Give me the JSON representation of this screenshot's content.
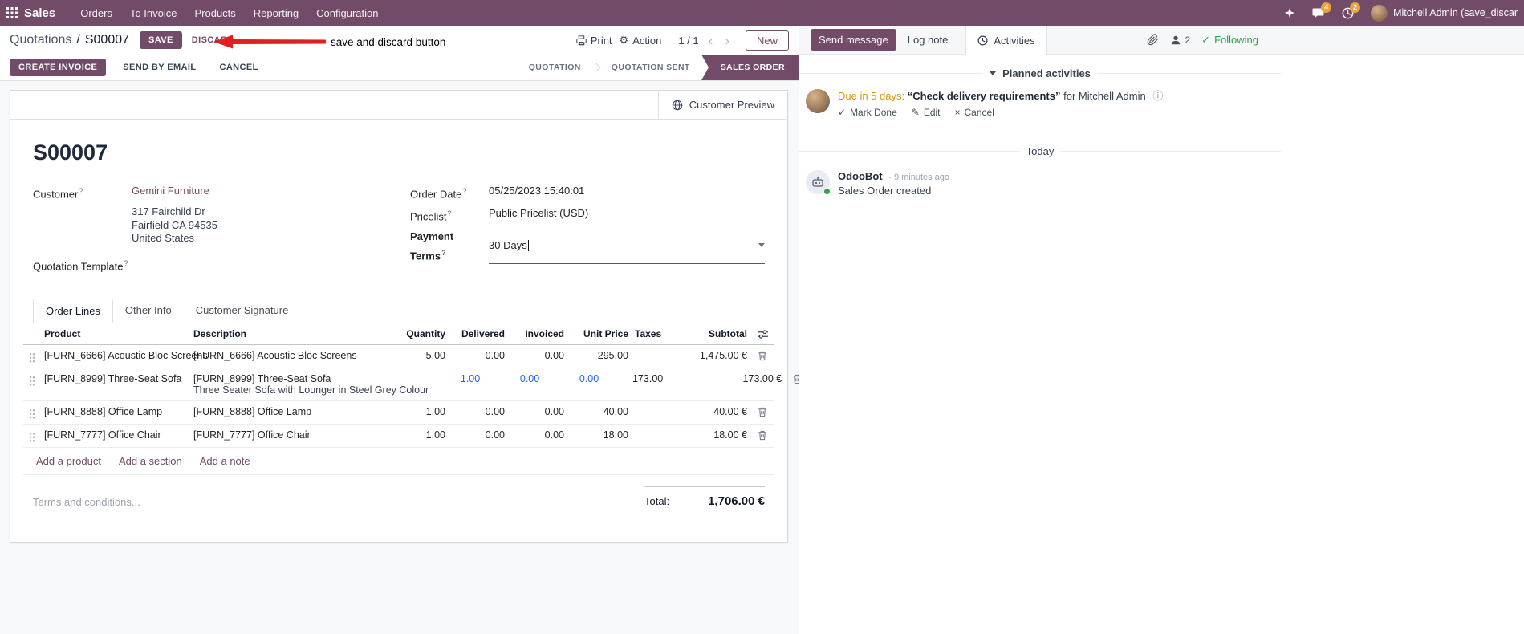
{
  "colors": {
    "brand_purple": "#714B67",
    "link_purple": "#714B67",
    "edited_value_blue": "#2563eb",
    "activity_due_orange": "#d9930d",
    "following_green": "#28a745",
    "badge_amber": "#EAA335",
    "annotation_red": "#e02020"
  },
  "icons": {
    "help": "?",
    "gear": "⚙",
    "chevron_left": "‹",
    "chevron_right": "›",
    "info": "ⓘ",
    "check": "✓",
    "pencil": "✎",
    "cross": "×"
  },
  "navbar": {
    "brand": "Sales",
    "menus": [
      "Orders",
      "To Invoice",
      "Products",
      "Reporting",
      "Configuration"
    ],
    "message_badge": "4",
    "activity_badge": "2",
    "user_name": "Mitchell Admin (save_discar"
  },
  "control_panel": {
    "breadcrumb_parent": "Quotations",
    "breadcrumb_separator": "/",
    "breadcrumb_current": "S00007",
    "save": "SAVE",
    "discard": "DISCARD",
    "print": "Print",
    "action": "Action",
    "pager": "1 / 1",
    "new": "New"
  },
  "annotation": {
    "label": "save and discard button"
  },
  "statusbar": {
    "buttons": [
      "CREATE INVOICE",
      "SEND BY EMAIL",
      "CANCEL"
    ],
    "steps": [
      {
        "label": "QUOTATION",
        "active": false
      },
      {
        "label": "QUOTATION SENT",
        "active": false
      },
      {
        "label": "SALES ORDER",
        "active": true
      }
    ]
  },
  "form": {
    "customer_preview": "Customer Preview",
    "title": "S00007",
    "customer_label": "Customer",
    "customer": "Gemini Furniture",
    "address": [
      "317 Fairchild Dr",
      "Fairfield CA 94535",
      "United States"
    ],
    "quotation_template_label": "Quotation Template",
    "order_date_label": "Order Date",
    "order_date": "05/25/2023 15:40:01",
    "pricelist_label": "Pricelist",
    "pricelist": "Public Pricelist (USD)",
    "payment_terms_label": "Payment Terms",
    "payment_terms": "30 Days",
    "tabs": [
      "Order Lines",
      "Other Info",
      "Customer Signature"
    ],
    "table": {
      "headers": {
        "product": "Product",
        "description": "Description",
        "quantity": "Quantity",
        "delivered": "Delivered",
        "invoiced": "Invoiced",
        "unit_price": "Unit Price",
        "taxes": "Taxes",
        "subtotal": "Subtotal"
      },
      "rows": [
        {
          "product": "[FURN_6666] Acoustic Bloc Screens",
          "description": "[FURN_6666] Acoustic Bloc Screens",
          "quantity": "5.00",
          "delivered": "0.00",
          "invoiced": "0.00",
          "unit_price": "295.00",
          "subtotal": "1,475.00 €"
        },
        {
          "product": "[FURN_8999] Three-Seat Sofa",
          "description": "[FURN_8999] Three-Seat Sofa",
          "description2": "Three Seater Sofa with Lounger in Steel Grey Colour",
          "quantity": "1.00",
          "delivered": "0.00",
          "invoiced": "0.00",
          "unit_price": "173.00",
          "subtotal": "173.00 €"
        },
        {
          "product": "[FURN_8888] Office Lamp",
          "description": "[FURN_8888] Office Lamp",
          "quantity": "1.00",
          "delivered": "0.00",
          "invoiced": "0.00",
          "unit_price": "40.00",
          "subtotal": "40.00 €"
        },
        {
          "product": "[FURN_7777] Office Chair",
          "description": "[FURN_7777] Office Chair",
          "quantity": "1.00",
          "delivered": "0.00",
          "invoiced": "0.00",
          "unit_price": "18.00",
          "subtotal": "18.00 €"
        }
      ],
      "add_links": [
        "Add a product",
        "Add a section",
        "Add a note"
      ]
    },
    "terms_placeholder": "Terms and conditions...",
    "total_label": "Total:",
    "total_value": "1,706.00 €"
  },
  "chatter": {
    "send_message": "Send message",
    "log_note": "Log note",
    "activities": "Activities",
    "followers_count": "2",
    "following": "Following",
    "planned_activities": "Planned activities",
    "activity": {
      "due": "Due in 5 days:",
      "summary": "“Check delivery requirements”",
      "assignee": "for Mitchell Admin",
      "mark_done": "Mark Done",
      "edit": "Edit",
      "cancel": "Cancel"
    },
    "date_divider": "Today",
    "message": {
      "author": "OdooBot",
      "time": "- 9 minutes ago",
      "body": "Sales Order created"
    }
  }
}
